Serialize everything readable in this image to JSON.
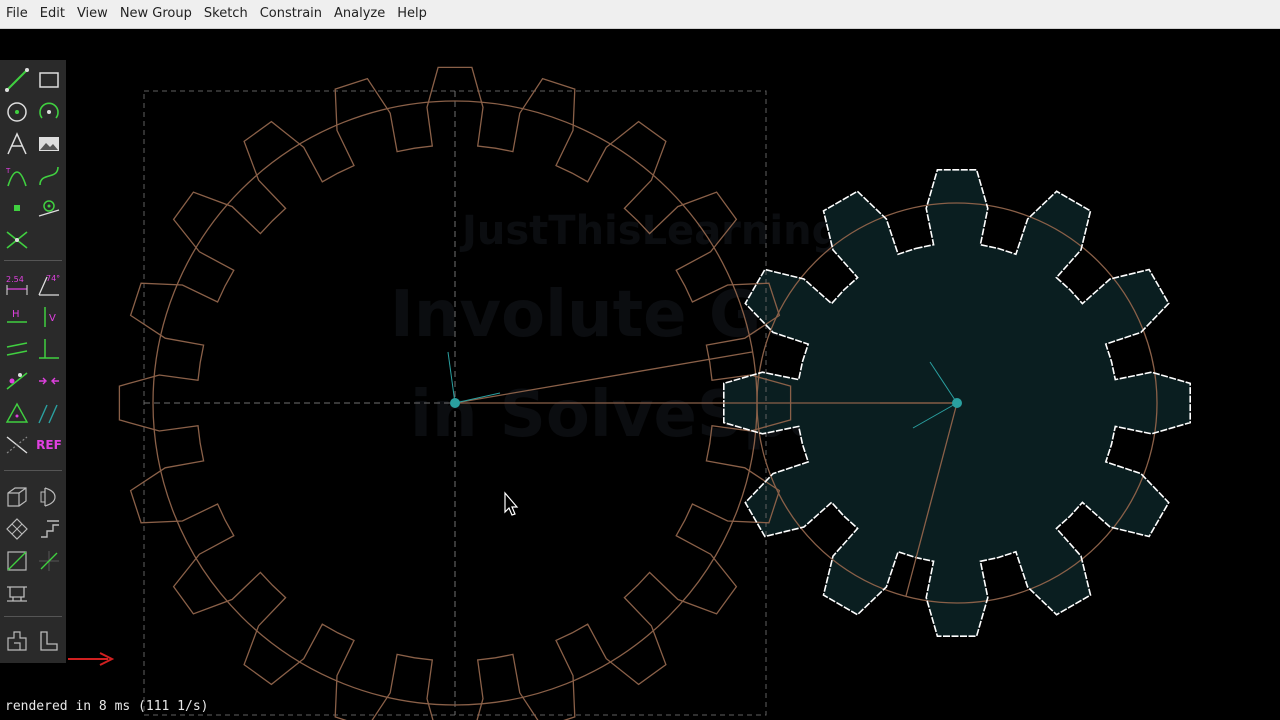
{
  "menubar": {
    "items": [
      "File",
      "Edit",
      "View",
      "New Group",
      "Sketch",
      "Constrain",
      "Analyze",
      "Help"
    ]
  },
  "watermark": {
    "line1": "JustThisLearning",
    "line2": "Involute Gears",
    "line3": "in SolveSpace"
  },
  "toolbar": {
    "ref_label": "REF",
    "dim_label": "2.54",
    "angle_label": "74°",
    "h_label": "H",
    "v_label": "V"
  },
  "status": {
    "text": "rendered in 8 ms (111 1/s)"
  },
  "colors": {
    "menubar_bg": "#efefef",
    "canvas_bg": "#000000",
    "gear_outline": "#8a6048",
    "selected_outline": "#ffffff",
    "active_fill": "#0a1e20",
    "construction": "#606060",
    "axis_x": "#c03030",
    "tool_green": "#40d040",
    "tool_magenta": "#e040e0",
    "origin": "#2aa0a0"
  },
  "icons": [
    "line-tool-icon",
    "rectangle-tool-icon",
    "circle-tool-icon",
    "arc-tool-icon",
    "text-tool-icon",
    "image-tool-icon",
    "tangent-arc-icon",
    "bezier-icon",
    "point-tool-icon",
    "workplane-icon",
    "split-curves-icon",
    "distance-constraint-icon",
    "angle-constraint-icon",
    "horizontal-constraint-icon",
    "vertical-constraint-icon",
    "parallel-constraint-icon",
    "perpendicular-constraint-icon",
    "point-on-line-icon",
    "symmetric-icon",
    "equal-constraint-icon",
    "same-orientation-icon",
    "construction-icon",
    "reference-icon",
    "step-translate-icon",
    "step-rotate-icon",
    "extrude-icon",
    "lathe-icon",
    "nearest-iso-icon",
    "nearest-ortho-icon",
    "workplane-group-icon",
    "sketch-in-3d-icon"
  ]
}
